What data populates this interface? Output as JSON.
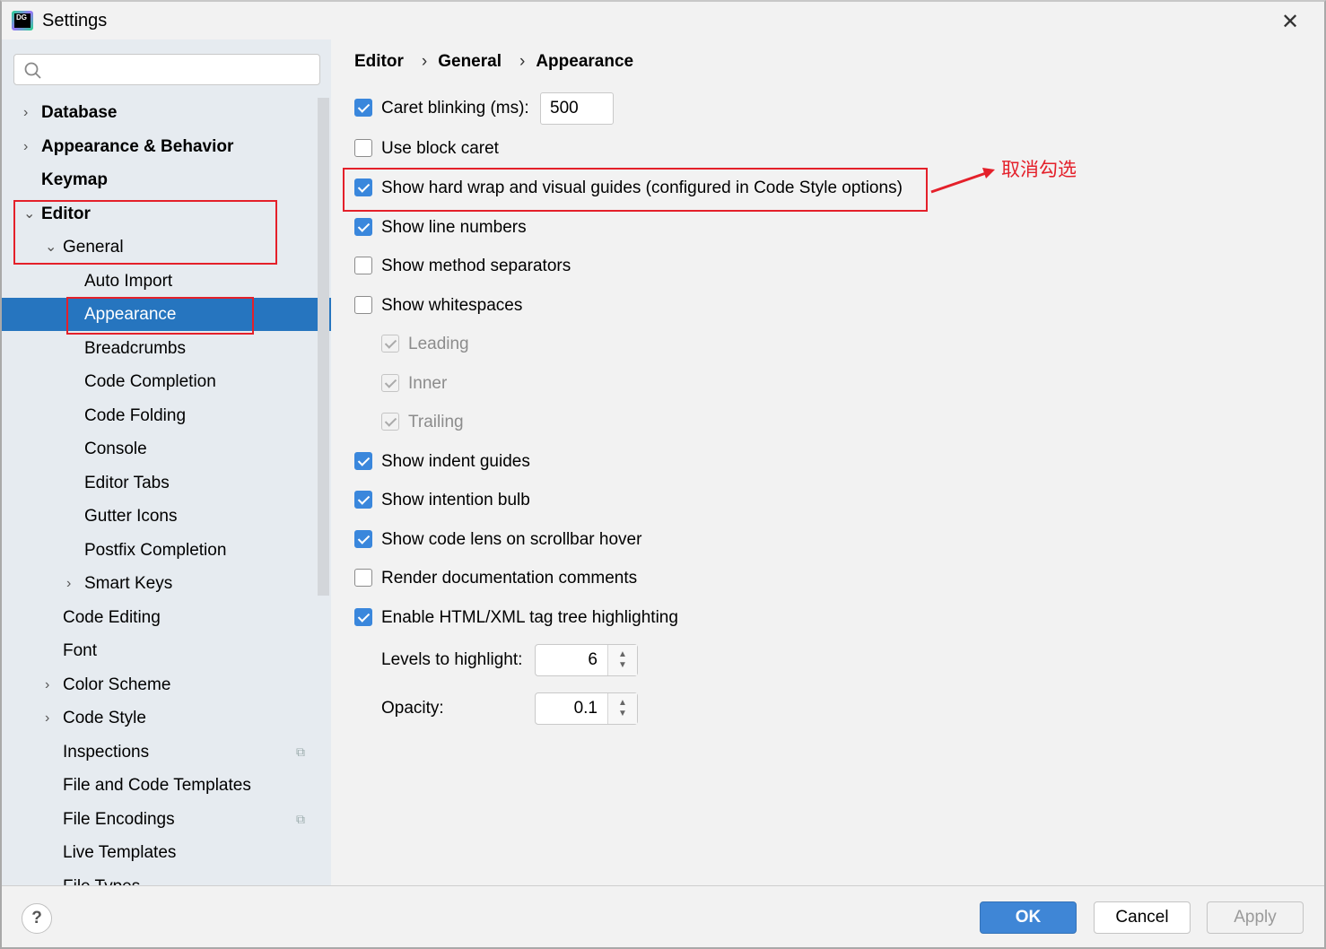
{
  "window": {
    "title": "Settings",
    "logo_text": "DG",
    "close": "✕"
  },
  "sidebar": {
    "search_placeholder": "",
    "items": [
      {
        "label": "Database",
        "level": 0,
        "bold": true,
        "chevron": "›"
      },
      {
        "label": "Appearance & Behavior",
        "level": 0,
        "bold": true,
        "chevron": "›"
      },
      {
        "label": "Keymap",
        "level": 0,
        "bold": true,
        "chevron": ""
      },
      {
        "label": "Editor",
        "level": 0,
        "bold": true,
        "chevron": "⌄"
      },
      {
        "label": "General",
        "level": 1,
        "bold": false,
        "chevron": "⌄"
      },
      {
        "label": "Auto Import",
        "level": 2,
        "bold": false,
        "chevron": ""
      },
      {
        "label": "Appearance",
        "level": 2,
        "bold": false,
        "chevron": "",
        "selected": true
      },
      {
        "label": "Breadcrumbs",
        "level": 2,
        "bold": false,
        "chevron": ""
      },
      {
        "label": "Code Completion",
        "level": 2,
        "bold": false,
        "chevron": ""
      },
      {
        "label": "Code Folding",
        "level": 2,
        "bold": false,
        "chevron": ""
      },
      {
        "label": "Console",
        "level": 2,
        "bold": false,
        "chevron": ""
      },
      {
        "label": "Editor Tabs",
        "level": 2,
        "bold": false,
        "chevron": ""
      },
      {
        "label": "Gutter Icons",
        "level": 2,
        "bold": false,
        "chevron": ""
      },
      {
        "label": "Postfix Completion",
        "level": 2,
        "bold": false,
        "chevron": ""
      },
      {
        "label": "Smart Keys",
        "level": 2,
        "bold": false,
        "chevron": "›"
      },
      {
        "label": "Code Editing",
        "level": 1,
        "bold": false,
        "chevron": ""
      },
      {
        "label": "Font",
        "level": 1,
        "bold": false,
        "chevron": ""
      },
      {
        "label": "Color Scheme",
        "level": 1,
        "bold": false,
        "chevron": "›"
      },
      {
        "label": "Code Style",
        "level": 1,
        "bold": false,
        "chevron": "›"
      },
      {
        "label": "Inspections",
        "level": 1,
        "bold": false,
        "chevron": "",
        "project_icon": true
      },
      {
        "label": "File and Code Templates",
        "level": 1,
        "bold": false,
        "chevron": ""
      },
      {
        "label": "File Encodings",
        "level": 1,
        "bold": false,
        "chevron": "",
        "project_icon": true
      },
      {
        "label": "Live Templates",
        "level": 1,
        "bold": false,
        "chevron": ""
      },
      {
        "label": "File Types",
        "level": 1,
        "bold": false,
        "chevron": ""
      }
    ]
  },
  "breadcrumb": [
    "Editor",
    "General",
    "Appearance"
  ],
  "breadcrumb_sep": "›",
  "options": [
    {
      "label": "Caret blinking (ms):",
      "checked": true,
      "value": "500"
    },
    {
      "label": "Use block caret",
      "checked": false
    },
    {
      "label": "Show hard wrap and visual guides (configured in Code Style options)",
      "checked": true
    },
    {
      "label": "Show line numbers",
      "checked": true
    },
    {
      "label": "Show method separators",
      "checked": false
    },
    {
      "label": "Show whitespaces",
      "checked": false
    },
    {
      "label": "Leading",
      "checked": true,
      "disabled": true,
      "sub": true
    },
    {
      "label": "Inner",
      "checked": true,
      "disabled": true,
      "sub": true
    },
    {
      "label": "Trailing",
      "checked": true,
      "disabled": true,
      "sub": true
    },
    {
      "label": "Show indent guides",
      "checked": true
    },
    {
      "label": "Show intention bulb",
      "checked": true
    },
    {
      "label": "Show code lens on scrollbar hover",
      "checked": true
    },
    {
      "label": "Render documentation comments",
      "checked": false
    },
    {
      "label": "Enable HTML/XML tag tree highlighting",
      "checked": true
    }
  ],
  "levels": {
    "label": "Levels to highlight:",
    "value": "6"
  },
  "opacity": {
    "label": "Opacity:",
    "value": "0.1"
  },
  "annotation": "取消勾选",
  "footer": {
    "help": "?",
    "ok": "OK",
    "cancel": "Cancel",
    "apply": "Apply"
  }
}
